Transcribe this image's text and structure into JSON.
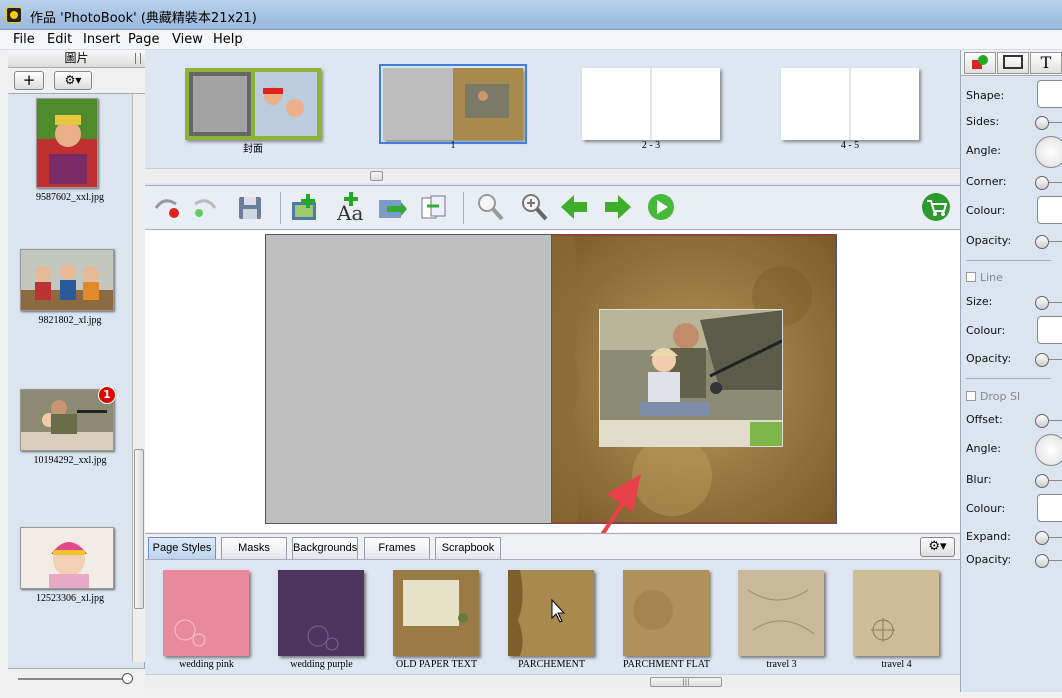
{
  "window": {
    "title": "作品 'PhotoBook' (典藏精裝本21x21)"
  },
  "menu": [
    "File",
    "Edit",
    "Insert",
    "Page",
    "View",
    "Help"
  ],
  "left_panel": {
    "header": "圖片",
    "add_label": "+",
    "gear_label": "⚙▾",
    "photos": [
      {
        "caption": "9587602_xxl.jpg"
      },
      {
        "caption": "9821802_xl.jpg"
      },
      {
        "caption": "10194292_xxl.jpg",
        "badge": "1"
      },
      {
        "caption": "12523306_xl.jpg"
      }
    ]
  },
  "pages": [
    {
      "label": "封面"
    },
    {
      "label": "1"
    },
    {
      "label": "2 - 3"
    },
    {
      "label": "4 - 5"
    }
  ],
  "toolbar": {
    "icons": [
      "undo-icon",
      "redo-icon",
      "save-icon",
      "add-photo-icon",
      "add-text-icon",
      "insert-page-icon",
      "page-options-icon",
      "zoom-out-icon",
      "zoom-in-icon",
      "back-arrow-icon",
      "forward-arrow-icon",
      "play-icon",
      "cart-icon"
    ]
  },
  "tabs": [
    "Page Styles",
    "Masks",
    "Backgrounds",
    "Frames",
    "Scrapbook"
  ],
  "active_tab": "Page Styles",
  "styles": [
    {
      "name": "wedding pink",
      "color": "#e98a9c"
    },
    {
      "name": "wedding purple",
      "color": "#4d3560"
    },
    {
      "name": "OLD PAPER TEXT",
      "color": "#9a7a45"
    },
    {
      "name": "PARCHEMENT",
      "color": "#a88a4e"
    },
    {
      "name": "PARCHMENT FLAT",
      "color": "#b0915a"
    },
    {
      "name": "travel 3",
      "color": "#c8b99a"
    },
    {
      "name": "travel 4",
      "color": "#cdbd98"
    }
  ],
  "properties": {
    "shape": "Shape:",
    "sides": "Sides:",
    "angle": "Angle:",
    "corner": "Corner:",
    "colour": "Colour:",
    "opacity": "Opacity:",
    "line": "Line",
    "size": "Size:",
    "line_colour": "Colour:",
    "line_opacity": "Opacity:",
    "drop": "Drop Sl",
    "offset": "Offset:",
    "drop_angle": "Angle:",
    "blur": "Blur:",
    "drop_colour": "Colour:",
    "expand": "Expand:",
    "drop_opacity": "Opacity:"
  },
  "right_tabs": {
    "text_tab": "T"
  },
  "scroll_grip": "|||",
  "colors": {
    "selection": "#3f7fd6",
    "parchment": "#a88a4e",
    "arrow": "#e8414a"
  }
}
